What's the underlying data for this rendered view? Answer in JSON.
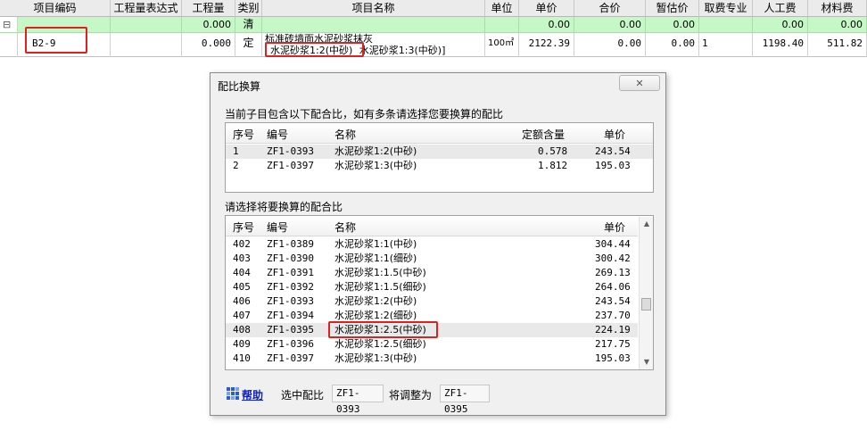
{
  "grid": {
    "headers": [
      "项目编码",
      "工程量表达式",
      "工程量",
      "类别",
      "项目名称",
      "单位",
      "单价",
      "合价",
      "暂估价",
      "取费专业",
      "人工费",
      "材料费"
    ],
    "expand_glyph": "⊟",
    "row1": {
      "code": "",
      "expr": "",
      "qty": "0.000",
      "cat": "清",
      "name": "",
      "unit": "",
      "price": "0.00",
      "total": "0.00",
      "est": "0.00",
      "fee": "",
      "labor": "0.00",
      "material": "0.00"
    },
    "row2": {
      "code": "B2-9",
      "expr": "",
      "qty": "0.000",
      "cat": "定",
      "name_line1": "标准砖墙面水泥砂浆抹灰",
      "name_line2_a": "水泥砂浆1:2(中砂)",
      "name_line2_b": "水泥砂浆1:3(中砂)]",
      "unit": "100㎡",
      "price": "2122.39",
      "total": "0.00",
      "est": "0.00",
      "fee": "1",
      "labor": "1198.40",
      "material": "511.82"
    }
  },
  "dialog": {
    "title": "配比换算",
    "close_glyph": "✕",
    "section1_label": "当前子目包含以下配合比，如有多条请选择您要换算的配比",
    "section2_label": "请选择将要换算的配合比",
    "table1": {
      "headers": [
        "序号",
        "编号",
        "名称",
        "定额含量",
        "单价"
      ],
      "rows": [
        {
          "no": "1",
          "code": "ZF1-0393",
          "name": "水泥砂浆1:2(中砂)",
          "qty": "0.578",
          "price": "243.54"
        },
        {
          "no": "2",
          "code": "ZF1-0397",
          "name": "水泥砂浆1:3(中砂)",
          "qty": "1.812",
          "price": "195.03"
        }
      ]
    },
    "table2": {
      "headers": [
        "序号",
        "编号",
        "名称",
        "单价"
      ],
      "rows": [
        {
          "no": "402",
          "code": "ZF1-0389",
          "name": "水泥砂浆1:1(中砂)",
          "price": "304.44"
        },
        {
          "no": "403",
          "code": "ZF1-0390",
          "name": "水泥砂浆1:1(细砂)",
          "price": "300.42"
        },
        {
          "no": "404",
          "code": "ZF1-0391",
          "name": "水泥砂浆1:1.5(中砂)",
          "price": "269.13"
        },
        {
          "no": "405",
          "code": "ZF1-0392",
          "name": "水泥砂浆1:1.5(细砂)",
          "price": "264.06"
        },
        {
          "no": "406",
          "code": "ZF1-0393",
          "name": "水泥砂浆1:2(中砂)",
          "price": "243.54"
        },
        {
          "no": "407",
          "code": "ZF1-0394",
          "name": "水泥砂浆1:2(细砂)",
          "price": "237.70"
        },
        {
          "no": "408",
          "code": "ZF1-0395",
          "name": "水泥砂浆1:2.5(中砂)",
          "price": "224.19"
        },
        {
          "no": "409",
          "code": "ZF1-0396",
          "name": "水泥砂浆1:2.5(细砂)",
          "price": "217.75"
        },
        {
          "no": "410",
          "code": "ZF1-0397",
          "name": "水泥砂浆1:3(中砂)",
          "price": "195.03"
        }
      ]
    },
    "footer": {
      "help_label": "帮助",
      "selected_label": "选中配比",
      "selected_value": "ZF1-0393",
      "adjust_label": "将调整为",
      "adjust_value": "ZF1-0395"
    },
    "scroll_up_glyph": "▲",
    "scroll_down_glyph": "▼"
  },
  "colors": {
    "highlight_red": "#e02020",
    "row_green": "#c6f7c6",
    "link_blue": "#1020c0"
  }
}
